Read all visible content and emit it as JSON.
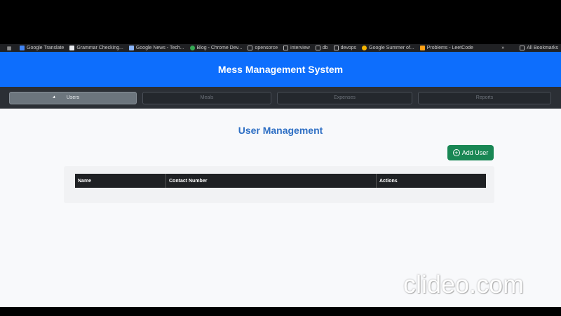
{
  "bookmarks": {
    "items": [
      {
        "label": "Google Translate",
        "icon": "translate-icon",
        "color": "#4285f4"
      },
      {
        "label": "Grammar Checking...",
        "icon": "grammar-icon",
        "color": "#e8eaed"
      },
      {
        "label": "Google News - Tech...",
        "icon": "news-icon",
        "color": "#8ab4f8"
      },
      {
        "label": "Blog - Chrome Dev...",
        "icon": "chrome-icon",
        "color": "#34a853"
      },
      {
        "label": "opensorce",
        "icon": "folder-icon",
        "color": ""
      },
      {
        "label": "interview",
        "icon": "folder-icon",
        "color": ""
      },
      {
        "label": "db",
        "icon": "folder-icon",
        "color": ""
      },
      {
        "label": "devops",
        "icon": "folder-icon",
        "color": ""
      },
      {
        "label": "Google Summer of...",
        "icon": "gsoc-icon",
        "color": "#f4b400"
      },
      {
        "label": "Problems - LeetCode",
        "icon": "leetcode-icon",
        "color": "#ffa116"
      }
    ],
    "all_bookmarks": "All Bookmarks"
  },
  "header": {
    "title": "Mess Management System",
    "color": "#0d6efd"
  },
  "nav": {
    "tabs": [
      {
        "label": "Users",
        "active": true
      },
      {
        "label": "Meals",
        "active": false
      },
      {
        "label": "Expenses",
        "active": false
      },
      {
        "label": "Reports",
        "active": false
      }
    ]
  },
  "main": {
    "title": "User Management",
    "add_button": "Add User",
    "table": {
      "columns": [
        "Name",
        "Contact Number",
        "Actions"
      ],
      "rows": []
    }
  },
  "watermark": "clideo.com"
}
